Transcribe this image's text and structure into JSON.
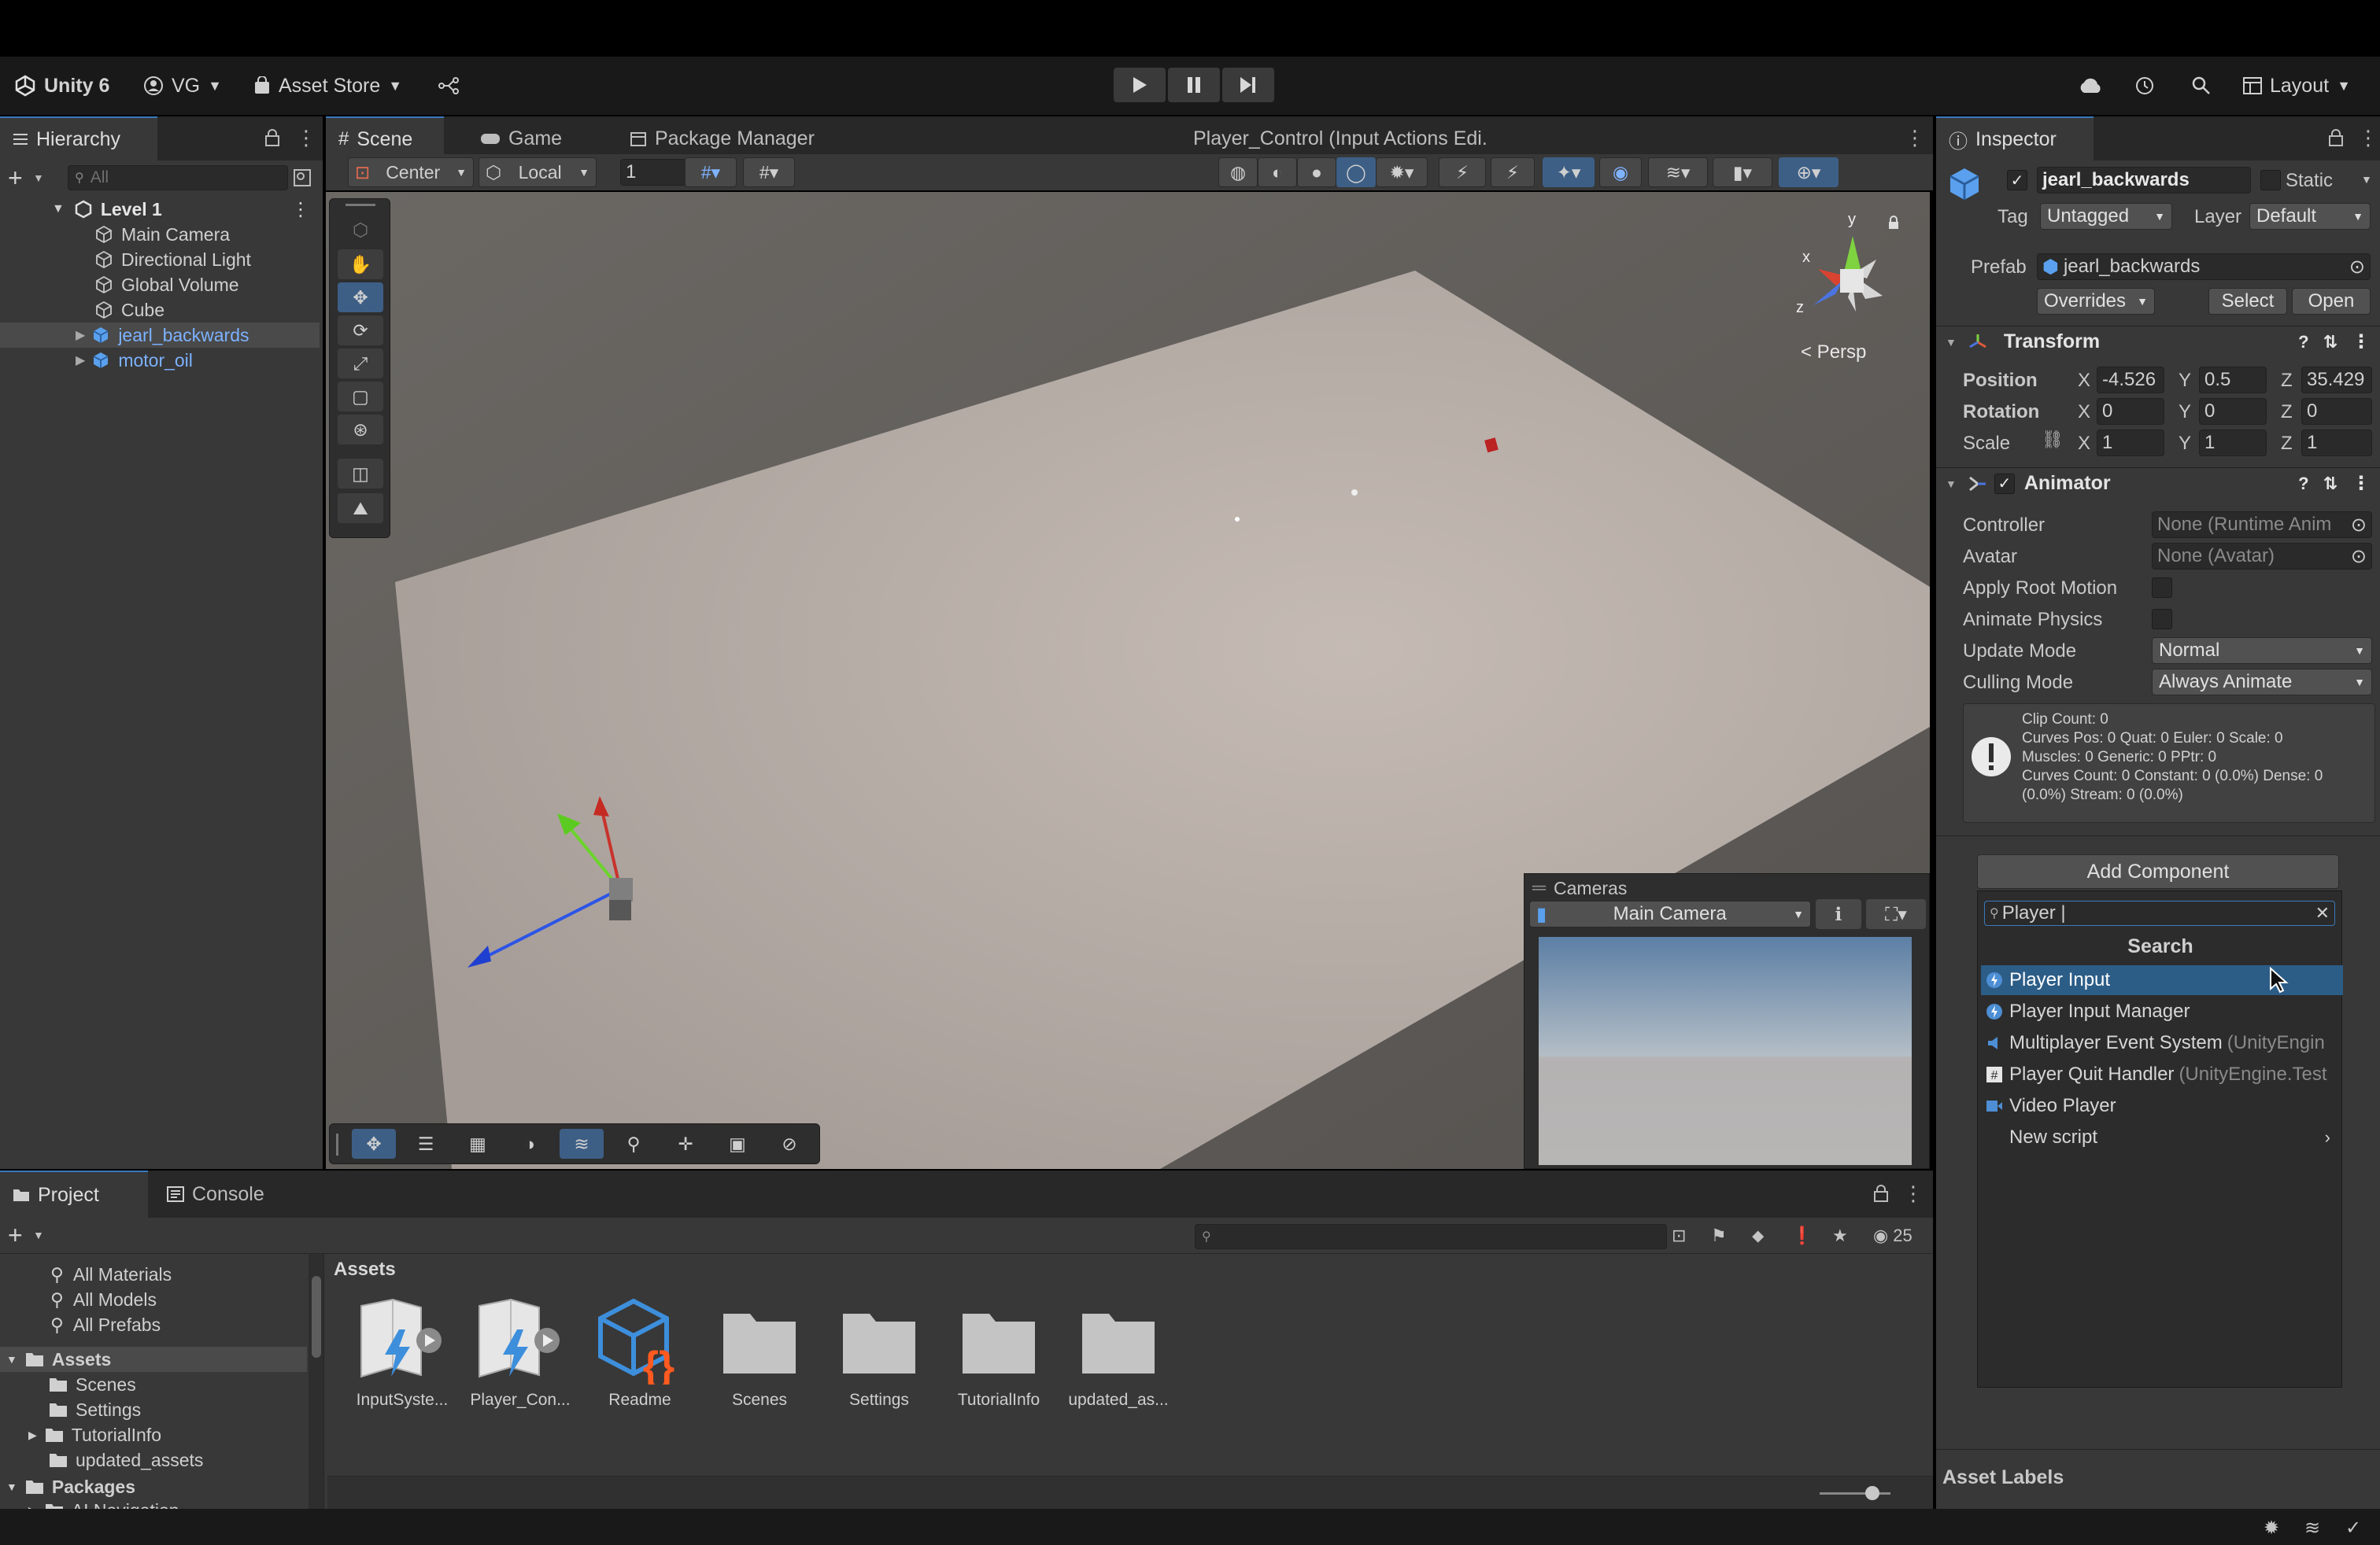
{
  "topbar": {
    "app": "Unity 6",
    "account": "VG",
    "asset_store": "Asset Store",
    "layout": "Layout"
  },
  "hierarchy": {
    "tab": "Hierarchy",
    "search_placeholder": "All",
    "root": "Level 1",
    "items": [
      "Main Camera",
      "Directional Light",
      "Global Volume",
      "Cube",
      "jearl_backwards",
      "motor_oil"
    ]
  },
  "scene_tabs": {
    "scene": "Scene",
    "game": "Game",
    "package_manager": "Package Manager",
    "input_actions": "Player_Control (Input Actions Edi."
  },
  "scene_toolbar": {
    "pivot": "Center",
    "space": "Local",
    "grid_value": "1",
    "persp": "< Persp",
    "gizmo_y": "y",
    "gizmo_x": "x",
    "gizmo_z": "z"
  },
  "cameras_overlay": {
    "title": "Cameras",
    "selected": "Main Camera"
  },
  "inspector": {
    "tab": "Inspector",
    "object_name": "jearl_backwards",
    "static_label": "Static",
    "tag_label": "Tag",
    "tag_value": "Untagged",
    "layer_label": "Layer",
    "layer_value": "Default",
    "prefab_label": "Prefab",
    "prefab_value": "jearl_backwards",
    "overrides": "Overrides",
    "select": "Select",
    "open": "Open",
    "transform": {
      "title": "Transform",
      "position_label": "Position",
      "rotation_label": "Rotation",
      "scale_label": "Scale",
      "x": "X",
      "y": "Y",
      "z": "Z",
      "position": [
        "-4.526",
        "0.5",
        "35.429"
      ],
      "rotation": [
        "0",
        "0",
        "0"
      ],
      "scale": [
        "1",
        "1",
        "1"
      ]
    },
    "animator": {
      "title": "Animator",
      "controller_label": "Controller",
      "controller_value": "None (Runtime Anim",
      "avatar_label": "Avatar",
      "avatar_value": "None (Avatar)",
      "apply_root_motion": "Apply Root Motion",
      "animate_physics": "Animate Physics",
      "update_mode_label": "Update Mode",
      "update_mode_value": "Normal",
      "culling_mode_label": "Culling Mode",
      "culling_mode_value": "Always Animate",
      "info": [
        "Clip Count: 0",
        "Curves Pos: 0 Quat: 0 Euler: 0 Scale: 0",
        "Muscles: 0 Generic: 0 PPtr: 0",
        "Curves Count: 0 Constant: 0 (0.0%) Dense: 0",
        "(0.0%) Stream: 0 (0.0%)"
      ]
    },
    "add_component": "Add Component",
    "asset_labels": "Asset Labels"
  },
  "add_component_popup": {
    "search_value": "Player |",
    "heading": "Search",
    "items": [
      {
        "label": "Player Input",
        "extra": ""
      },
      {
        "label": "Player Input Manager",
        "extra": ""
      },
      {
        "label": "Multiplayer Event System",
        "extra": "(UnityEngin"
      },
      {
        "label": "Player Quit Handler",
        "extra": "(UnityEngine.Test"
      },
      {
        "label": "Video Player",
        "extra": ""
      },
      {
        "label": "New script",
        "extra": ""
      }
    ]
  },
  "project": {
    "tab_project": "Project",
    "tab_console": "Console",
    "hidden_count": "25",
    "favorites": [
      "All Materials",
      "All Models",
      "All Prefabs"
    ],
    "assets_root": "Assets",
    "asset_folders": [
      "Scenes",
      "Settings",
      "TutorialInfo",
      "updated_assets"
    ],
    "packages_root": "Packages",
    "package_partial": "AI Navigation",
    "breadcrumb": "Assets",
    "grid": [
      "InputSyste...",
      "Player_Con...",
      "Readme",
      "Scenes",
      "Settings",
      "TutorialInfo",
      "updated_as..."
    ]
  },
  "colors": {
    "accent": "#3a79bb",
    "selection": "#2c5d87",
    "background": "#383838"
  }
}
